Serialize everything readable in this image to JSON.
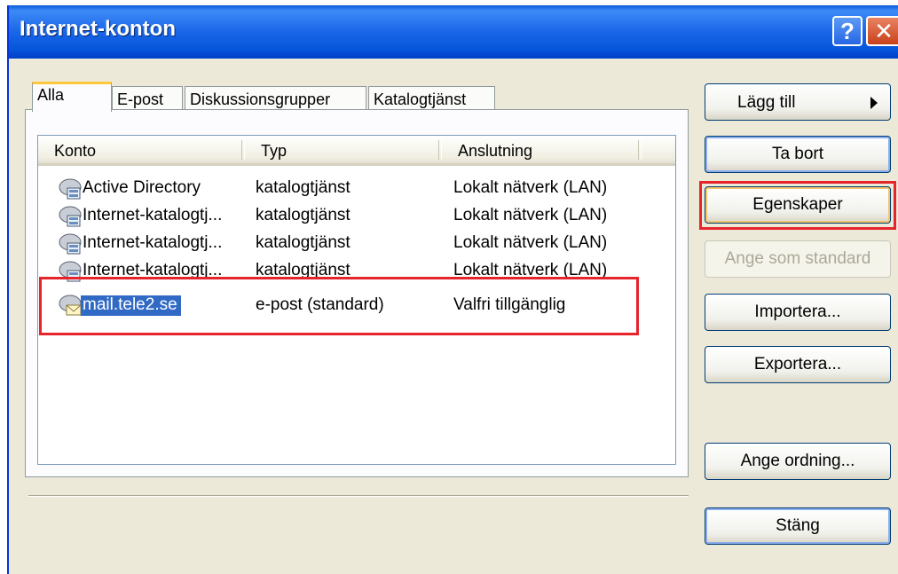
{
  "window": {
    "title": "Internet-konton",
    "help_glyph": "?",
    "close_glyph": "✕"
  },
  "tabs": [
    {
      "label": "Alla",
      "active": true
    },
    {
      "label": "E-post",
      "active": false
    },
    {
      "label": "Diskussionsgrupper",
      "active": false
    },
    {
      "label": "Katalogtjänst",
      "active": false
    }
  ],
  "list": {
    "columns": [
      "Konto",
      "Typ",
      "Anslutning"
    ],
    "rows": [
      {
        "icon": "directory-service-icon",
        "account": "Active Directory",
        "type": "katalogtjänst",
        "connection": "Lokalt nätverk (LAN)"
      },
      {
        "icon": "directory-service-icon",
        "account": "Internet-katalogtj...",
        "type": "katalogtjänst",
        "connection": "Lokalt nätverk (LAN)"
      },
      {
        "icon": "directory-service-icon",
        "account": "Internet-katalogtj...",
        "type": "katalogtjänst",
        "connection": "Lokalt nätverk (LAN)"
      },
      {
        "icon": "directory-service-icon",
        "account": "Internet-katalogtj...",
        "type": "katalogtjänst",
        "connection": "Lokalt nätverk (LAN)"
      },
      {
        "icon": "mail-account-icon",
        "account": "mail.tele2.se",
        "type": "e-post (standard)",
        "connection": "Valfri tillgänglig",
        "selected": true
      }
    ]
  },
  "buttons": {
    "add": "Lägg till",
    "remove": "Ta bort",
    "properties": "Egenskaper",
    "set_default": "Ange som standard",
    "import": "Importera...",
    "export": "Exportera...",
    "set_order": "Ange ordning...",
    "close": "Stäng"
  },
  "colors": {
    "title_bar": "#0554d9",
    "selection": "#316ac5",
    "highlight_annotation": "#e5242b",
    "active_tab_accent": "#ffc83c"
  }
}
